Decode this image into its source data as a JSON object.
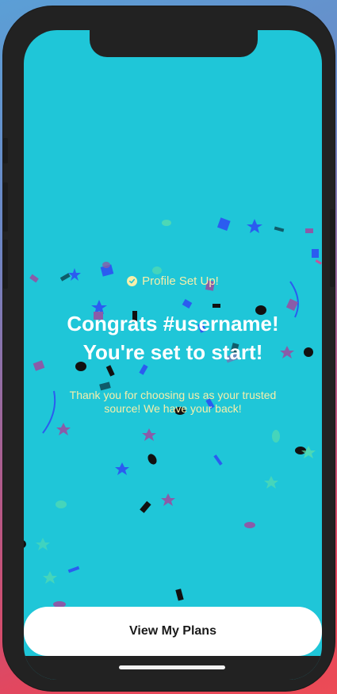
{
  "device": {
    "frame_color": "#222222",
    "screen_color": "#1fc6d8"
  },
  "badge": {
    "icon": "check-circle-icon",
    "label": "Profile Set Up!"
  },
  "headline": {
    "line1": "Congrats #username!",
    "line2": "You're set to start!"
  },
  "subtext": {
    "line1": "Thank you for choosing us as your trusted",
    "line2": "source! We have your back!"
  },
  "cta": {
    "label": "View My Plans"
  },
  "colors": {
    "accent_text": "#f6efaa",
    "title_text": "#ffffff",
    "button_bg": "#ffffff",
    "button_text": "#1a1a1a"
  },
  "decorations": {
    "confetti_icon": "confetti-icon"
  }
}
